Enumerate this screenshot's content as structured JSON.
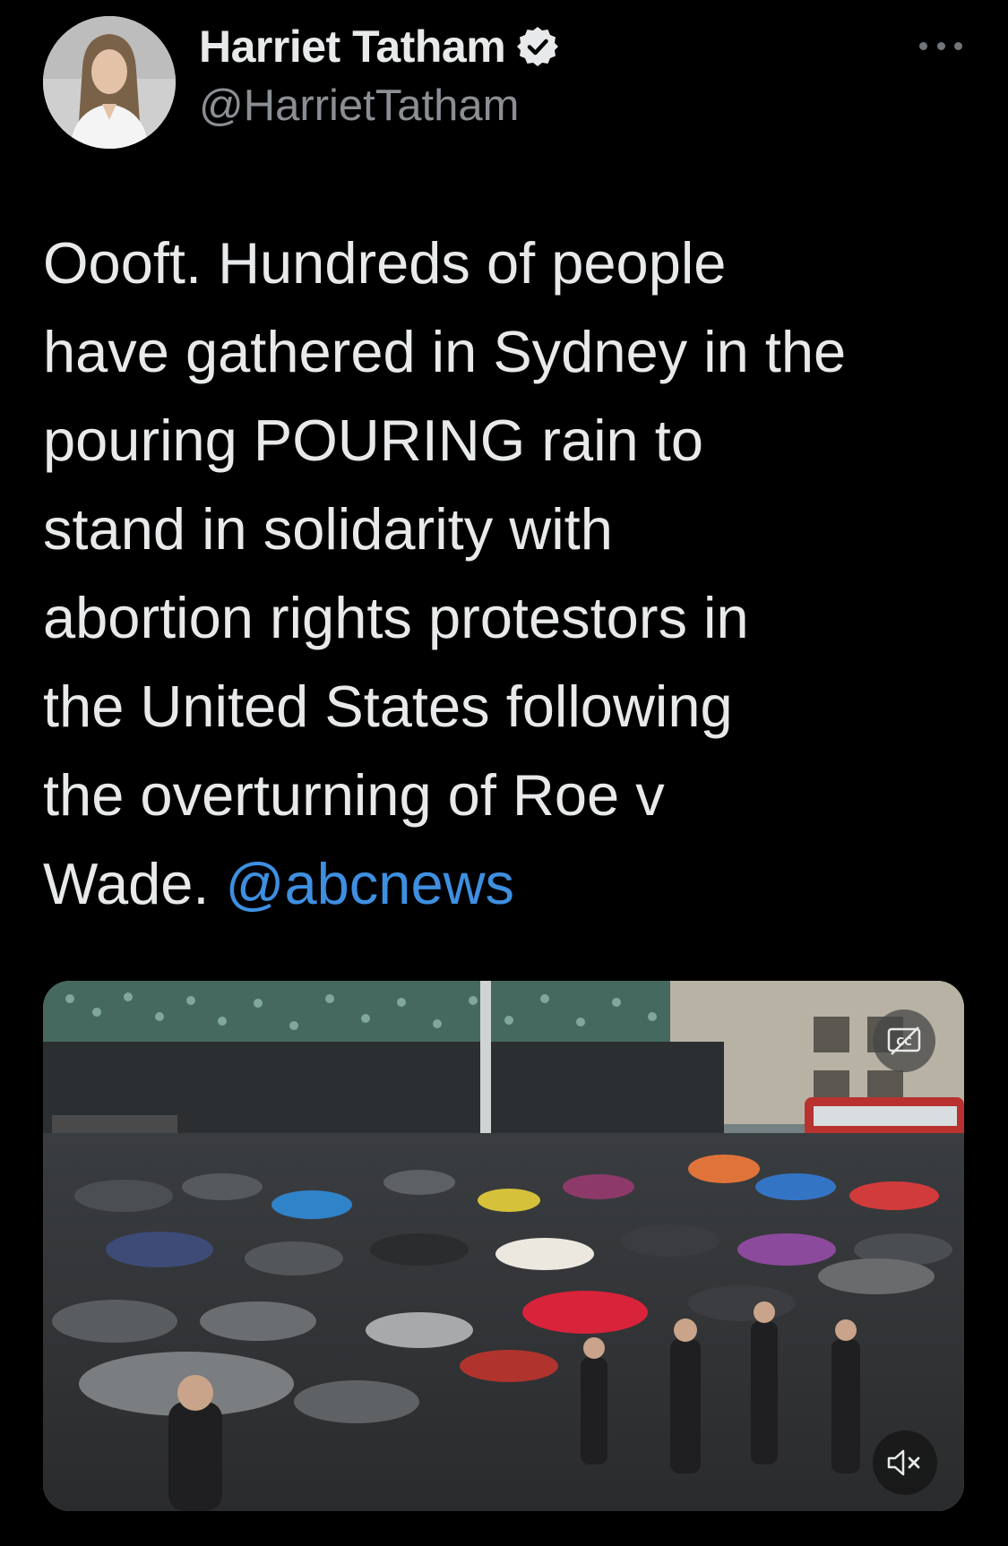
{
  "author": {
    "name": "Harriet Tatham",
    "handle": "@HarrietTatham",
    "verified": true
  },
  "tweet": {
    "lines": [
      "Oooft. Hundreds of people",
      "have gathered in Sydney in the",
      "pouring POURING rain to",
      "stand in solidarity with",
      "abortion rights protestors in",
      "the United States following",
      "the overturning of Roe v"
    ],
    "last_line_text": "Wade. ",
    "mention": "@abcnews"
  },
  "media": {
    "type": "video",
    "captions_button": "cc-icon",
    "mute_button": "speaker-muted-icon"
  },
  "colors": {
    "background": "#000000",
    "text": "#e7e9ea",
    "secondary_text": "#8b8f94",
    "link": "#3e8fe0"
  }
}
